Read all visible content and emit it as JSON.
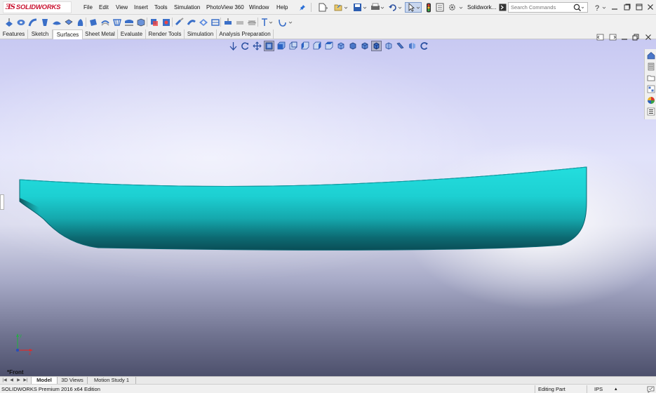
{
  "app": {
    "logo_ds": "ƎS",
    "logo_name": "SOLIDWORKS"
  },
  "menu": {
    "items": [
      "File",
      "Edit",
      "View",
      "Insert",
      "Tools",
      "Simulation",
      "PhotoView 360",
      "Window",
      "Help"
    ],
    "doc_title": "Solidwork..."
  },
  "search": {
    "placeholder": "Search Commands"
  },
  "tabs": {
    "items": [
      "Features",
      "Sketch",
      "Surfaces",
      "Sheet Metal",
      "Evaluate",
      "Render Tools",
      "Simulation",
      "Analysis Preparation"
    ],
    "active": "Surfaces"
  },
  "viewport": {
    "view_name": "*Front",
    "triad": {
      "x_axis": "x",
      "y_axis": "y"
    },
    "model_color": "#1fd6d6",
    "model_shadow_color": "#0b5f66"
  },
  "bottom_tabs": {
    "items": [
      "Model",
      "3D Views",
      "Motion Study 1"
    ],
    "active": "Model"
  },
  "status": {
    "product": "SOLIDWORKS Premium 2016 x64 Edition",
    "mode": "Editing Part",
    "units": "IPS",
    "units_arrow": "▴"
  },
  "icons": {
    "menubar": [
      "new-document-icon",
      "open-icon",
      "save-icon",
      "print-icon",
      "undo-icon",
      "select-icon",
      "rebuild-icon",
      "file-properties-icon",
      "options-icon",
      "help-icon"
    ],
    "heads_up": [
      "zoom-to-fit-icon",
      "zoom-area-icon",
      "previous-view-icon",
      "section-view-icon",
      "view-orientation-icon",
      "display-style-icon",
      "hide-show-icon",
      "edit-appearance-icon",
      "apply-scene-icon",
      "view-settings-icon"
    ],
    "task_pane": [
      "solidworks-resources-icon",
      "design-library-icon",
      "file-explorer-icon",
      "view-palette-icon",
      "appearances-icon",
      "custom-properties-icon"
    ]
  }
}
